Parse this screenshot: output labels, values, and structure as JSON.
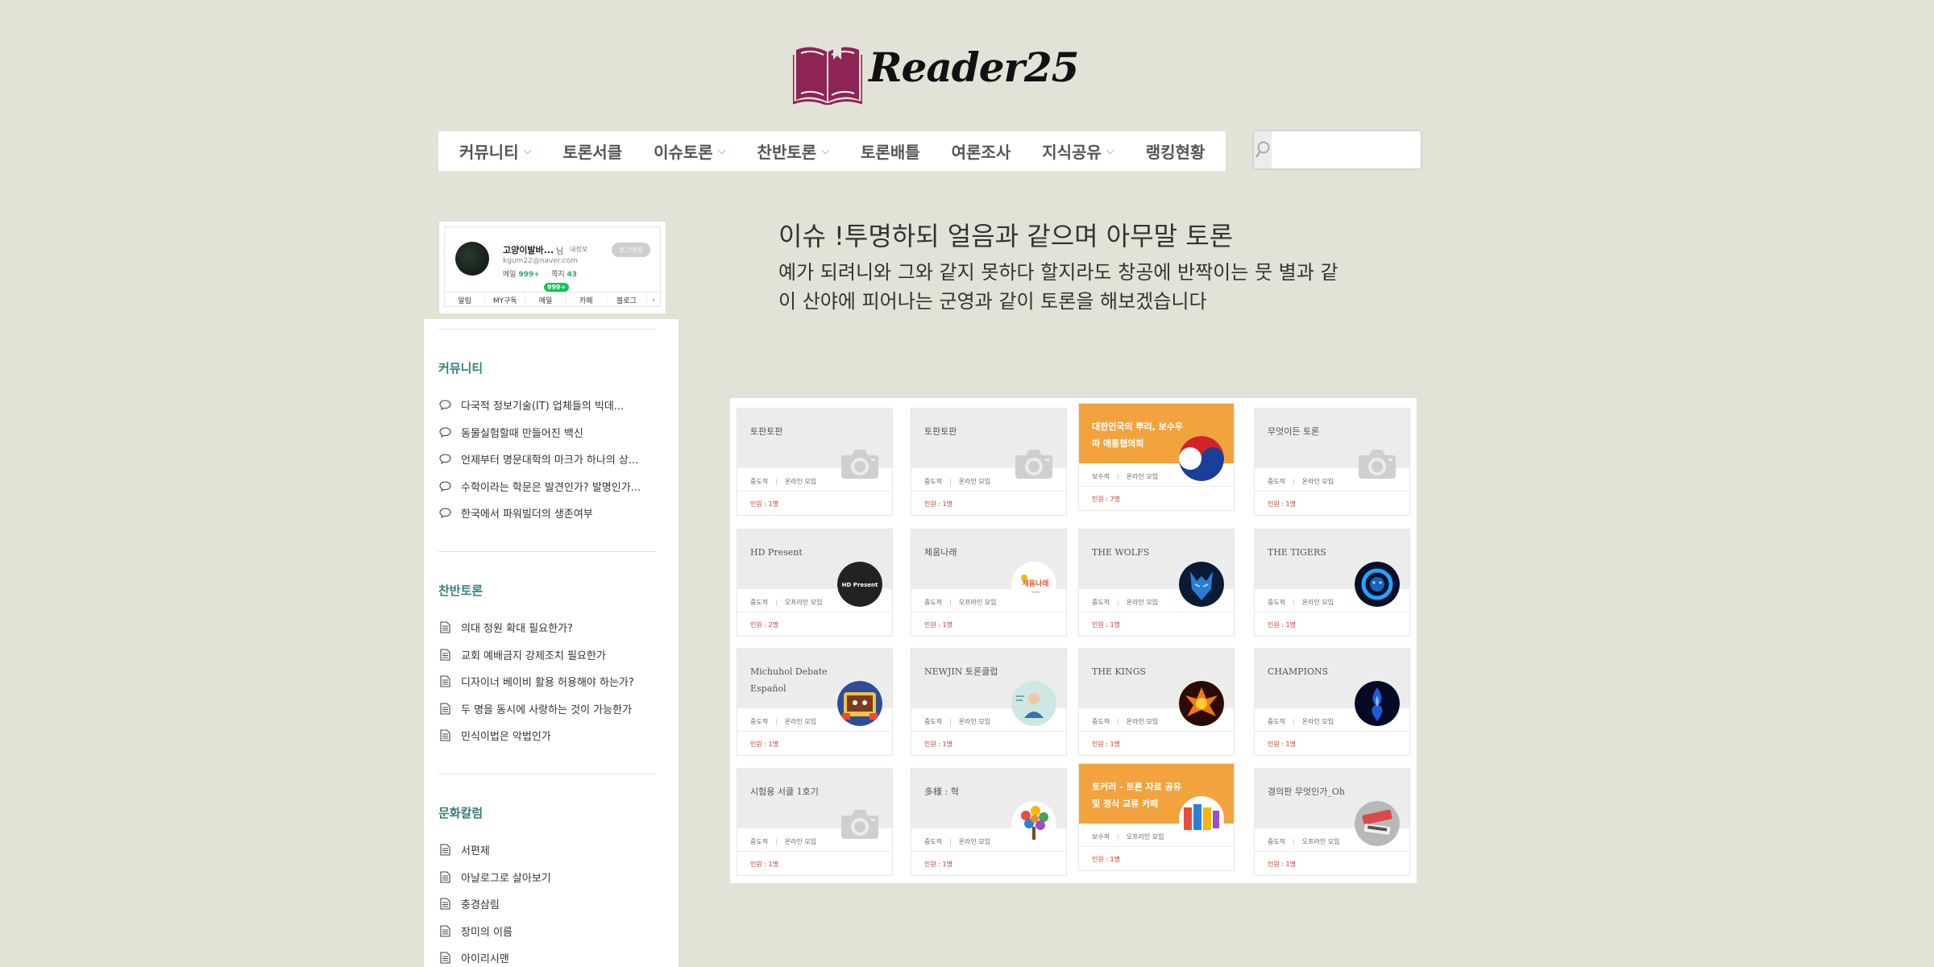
{
  "site": {
    "brand": "Reader25"
  },
  "nav": {
    "items": [
      {
        "label": "커뮤니티",
        "dropdown": true
      },
      {
        "label": "토론서클",
        "dropdown": false
      },
      {
        "label": "이슈토론",
        "dropdown": true
      },
      {
        "label": "찬반토론",
        "dropdown": true
      },
      {
        "label": "토론배틀",
        "dropdown": false
      },
      {
        "label": "여론조사",
        "dropdown": false
      },
      {
        "label": "지식공유",
        "dropdown": true
      },
      {
        "label": "랭킹현황",
        "dropdown": false
      }
    ],
    "search_placeholder": ""
  },
  "profile": {
    "name": "고양이발바...",
    "nim": "님",
    "myinfo": "내정보",
    "logout": "로그아웃",
    "email": "kgum22@naver.com",
    "mail_label": "메일",
    "mail_count": "999+",
    "note_label": "쪽지",
    "note_count": "43",
    "badge": "999+",
    "tabs": [
      "알림",
      "MY구독",
      "메일",
      "카페",
      "블로그"
    ]
  },
  "sidebar": {
    "sections": [
      {
        "title": "커뮤니티",
        "icon": "speech-bubble-icon",
        "items": [
          "다국적 정보기술(IT) 업체들의 빅데...",
          "동물실험할때 만들어진 백신",
          "언제부터 명문대학의 마크가 하나의 상...",
          "수학이라는 학문은 발견인가? 발명인가...",
          "한국에서 파워빌더의 생존여부"
        ]
      },
      {
        "title": "찬반토론",
        "icon": "document-icon",
        "items": [
          "의대 정원 확대 필요한가?",
          "교회 예배금지 강제조치 필요한가",
          "디자이너 베이비 활용 허용해야 하는가?",
          "두 명을 동시에 사랑하는 것이 가능한가",
          "민식이법은 악법인가"
        ]
      },
      {
        "title": "문화칼럼",
        "icon": "document-icon",
        "items": [
          "서편제",
          "아날로그로 살아보기",
          "충경삼림",
          "장미의 이름",
          "아이리시맨"
        ]
      }
    ]
  },
  "main": {
    "heading": "이슈 !투명하되 얼음과 같으며 아무말 토론",
    "description": "예가 되려니와 그와 같지 못하다 할지라도 창공에 반짝이는 뭇 별과 같이 산야에 피어나는 군영과 같이 토론을 해보겠습니다"
  },
  "circles": [
    {
      "title": "토판토판",
      "level": "중도적",
      "type": "온라인 모임",
      "members": "인원 : 1명",
      "thumb": "camera-icon",
      "orange": false
    },
    {
      "title": "토판토판",
      "level": "중도적",
      "type": "온라인 모임",
      "members": "인원 : 1명",
      "thumb": "camera-icon",
      "orange": false
    },
    {
      "title": "대한민국의 뿌리, 보수우파 애통협의회",
      "level": "보수적",
      "type": "온라인 모임",
      "members": "인원 : 7명",
      "thumb": "korean-flag-icon",
      "orange": true
    },
    {
      "title": "무엇이든 토론",
      "level": "중도적",
      "type": "온라인 모임",
      "members": "인원 : 1명",
      "thumb": "camera-icon",
      "orange": false
    },
    {
      "title": "HD Present",
      "level": "중도적",
      "type": "오프라인 모임",
      "members": "인원 : 2명",
      "thumb": "hd-present-logo",
      "thumb_text": "HD Present",
      "orange": false
    },
    {
      "title": "체움나래",
      "level": "중도적",
      "type": "오프라인 모임",
      "members": "인원 : 1명",
      "thumb": "chaeum-logo",
      "thumb_text": "체움나래",
      "orange": false
    },
    {
      "title": "THE WOLFS",
      "level": "중도적",
      "type": "온라인 모임",
      "members": "인원 : 1명",
      "thumb": "wolf-logo",
      "orange": false
    },
    {
      "title": "THE TIGERS",
      "level": "중도적",
      "type": "온라인 모임",
      "members": "인원 : 1명",
      "thumb": "lion-logo",
      "orange": false
    },
    {
      "title": "Michuhol Debate Español",
      "level": "중도적",
      "type": "온라인 모임",
      "members": "인원 : 1명",
      "thumb": "cartoon-logo",
      "orange": false
    },
    {
      "title": "NEWJIN 토론클럽",
      "level": "중도적",
      "type": "온라인 모임",
      "members": "인원 : 1명",
      "thumb": "person-logo",
      "orange": false
    },
    {
      "title": "THE KINGS",
      "level": "중도적",
      "type": "온라인 모임",
      "members": "인원 : 1명",
      "thumb": "phoenix-logo",
      "orange": false
    },
    {
      "title": "CHAMPIONS",
      "level": "중도적",
      "type": "온라인 모임",
      "members": "인원 : 1명",
      "thumb": "blue-flame-logo",
      "orange": false
    },
    {
      "title": "시험용 서클 1호기",
      "level": "중도적",
      "type": "온라인 모임",
      "members": "인원 : 1명",
      "thumb": "camera-icon",
      "orange": false
    },
    {
      "title": "多様 : 혁",
      "level": "중도적",
      "type": "온라인 모임",
      "members": "인원 : 1명",
      "thumb": "tree-logo",
      "orange": false
    },
    {
      "title": "토커러 - 토론 자료 공유 및 정식 교류 카페",
      "level": "보수적",
      "type": "오프라인 모임",
      "members": "인원 : 1명",
      "thumb": "colorful-letters-logo",
      "orange": true
    },
    {
      "title": "경의판 무엇인가_Oh",
      "level": "중도적",
      "type": "오프라인 모임",
      "members": "인원 : 1명",
      "thumb": "sticker-logo",
      "orange": false
    }
  ]
}
